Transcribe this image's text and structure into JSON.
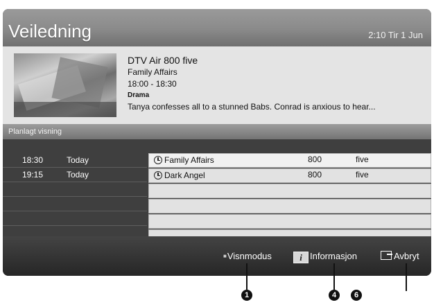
{
  "header": {
    "title": "Veiledning",
    "datetime": "2:10 Tir 1 Jun"
  },
  "info": {
    "channel": "DTV Air 800 five",
    "program": "Family Affairs",
    "time": "18:00 - 18:30",
    "genre": "Drama",
    "description": "Tanya confesses all to a stunned Babs. Conrad is anxious to hear..."
  },
  "schedule": {
    "title": "Planlagt visning",
    "rows": [
      {
        "time": "18:30",
        "day": "Today",
        "name": "Family Affairs",
        "number": "800",
        "channel": "five"
      },
      {
        "time": "19:15",
        "day": "Today",
        "name": "Dark Angel",
        "number": "800",
        "channel": "five"
      }
    ]
  },
  "footer": {
    "view_mode": "Visnmodus",
    "info": "Informasjon",
    "exit": "Avbryt"
  },
  "callouts": [
    "1",
    "4",
    "6"
  ],
  "icons": [
    "clock-icon",
    "info-icon",
    "exit-icon",
    "a-button-icon"
  ]
}
